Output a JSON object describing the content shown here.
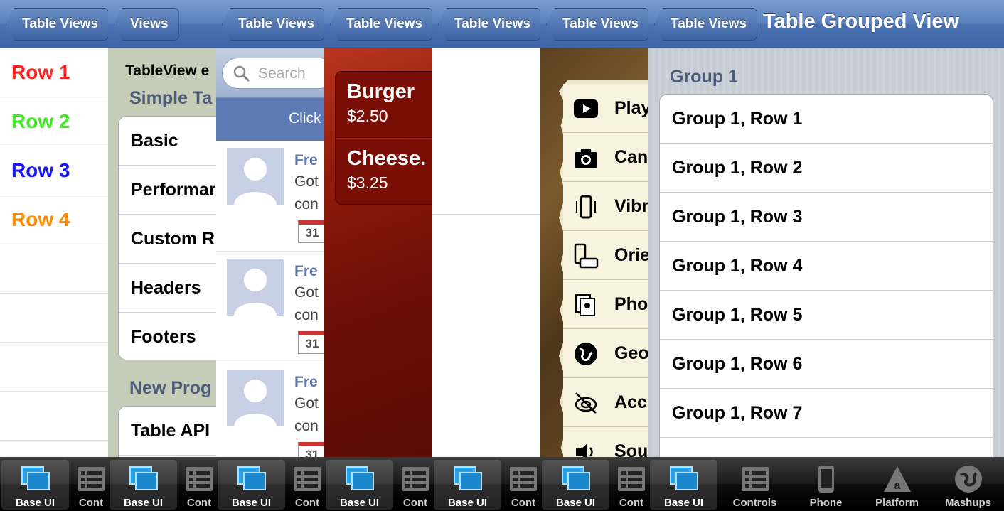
{
  "colors": {
    "nav_blue": "#4a72b2",
    "row1": "#ff2020",
    "row2": "#3fe823",
    "row3": "#1818ff",
    "row4": "#ff8a00",
    "group_header": "#4d5a79",
    "burger_red": "#7a0f08"
  },
  "panel1": {
    "back_label": "Table Views",
    "rows": [
      "Row 1",
      "Row 2",
      "Row 3",
      "Row 4"
    ]
  },
  "panel2": {
    "back_label": "Views",
    "header": "TableView e",
    "section1": "Simple Ta",
    "rows": [
      "Basic",
      "Performar",
      "Custom R",
      "Headers",
      "Footers"
    ],
    "section2": "New Prog",
    "row_table_api": "Table API"
  },
  "panel3": {
    "back_label": "Table Views",
    "search_placeholder": "Search",
    "click_text": "Click",
    "posts": [
      {
        "name": "Fre",
        "line1": "Got",
        "line2": "con",
        "cal": "31"
      },
      {
        "name": "Fre",
        "line1": "Got",
        "line2": "con",
        "cal": "31"
      },
      {
        "name": "Fre",
        "line1": "Got",
        "line2": "con",
        "cal": "31"
      }
    ]
  },
  "panel4": {
    "back_label": "Table Views",
    "items": [
      {
        "name": "Burger",
        "price": "$2.50"
      },
      {
        "name": "Cheese.",
        "price": "$3.25"
      }
    ]
  },
  "panel5": {
    "back_label": "Table Views"
  },
  "panel6": {
    "back_label": "Table Views",
    "rows": [
      {
        "icon": "play-icon",
        "label": "Play"
      },
      {
        "icon": "camera-icon",
        "label": "Can"
      },
      {
        "icon": "vibrate-icon",
        "label": "Vibr"
      },
      {
        "icon": "orientation-icon",
        "label": "Orie"
      },
      {
        "icon": "photos-icon",
        "label": "Pho"
      },
      {
        "icon": "globe-icon",
        "label": "Geo"
      },
      {
        "icon": "accelerometer-icon",
        "label": "Acc"
      },
      {
        "icon": "sound-icon",
        "label": "Sou"
      }
    ]
  },
  "panel7": {
    "back_label": "Table Views",
    "title": "Table Grouped View",
    "group_header": "Group 1",
    "rows": [
      "Group 1, Row 1",
      "Group 1, Row 2",
      "Group 1, Row 3",
      "Group 1, Row 4",
      "Group 1, Row 5",
      "Group 1, Row 6",
      "Group 1, Row 7"
    ]
  },
  "tabbar": {
    "base_ui": "Base UI",
    "controls_partial": "Cont",
    "controls": "Controls",
    "phone": "Phone",
    "platform": "Platform",
    "mashups": "Mashups"
  }
}
